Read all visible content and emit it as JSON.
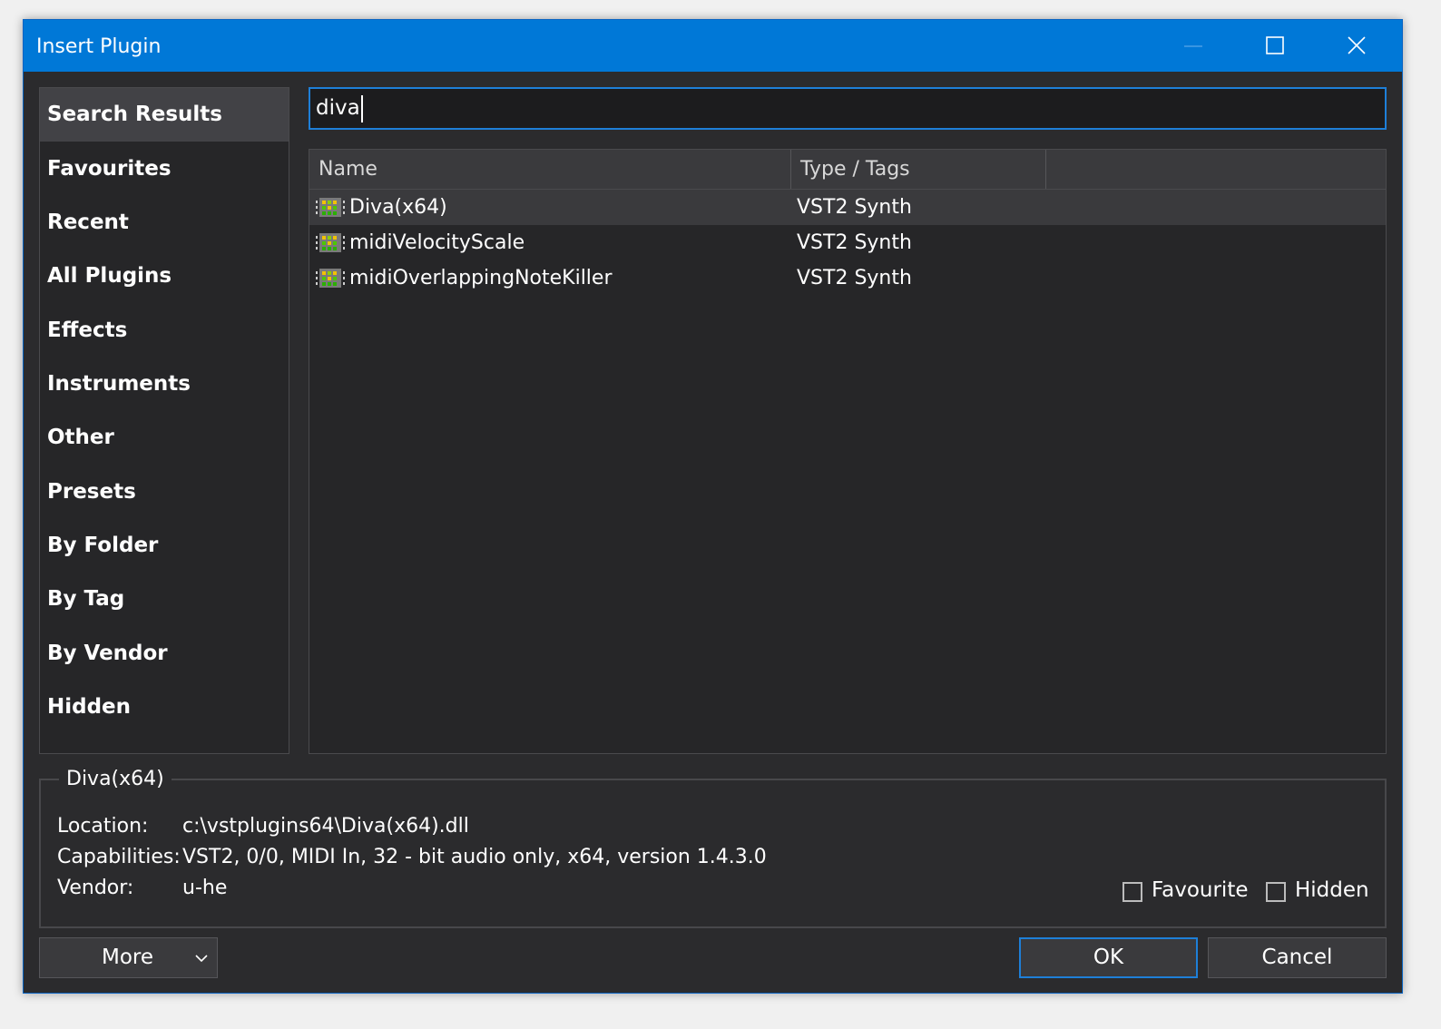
{
  "window": {
    "title": "Insert Plugin"
  },
  "sidebar": {
    "items": [
      {
        "label": "Search Results",
        "active": true
      },
      {
        "label": "Favourites"
      },
      {
        "label": "Recent"
      },
      {
        "label": "All Plugins"
      },
      {
        "label": "Effects"
      },
      {
        "label": "Instruments"
      },
      {
        "label": "Other"
      },
      {
        "label": "Presets"
      },
      {
        "label": "By Folder"
      },
      {
        "label": "By Tag"
      },
      {
        "label": "By Vendor"
      },
      {
        "label": "Hidden"
      }
    ]
  },
  "search": {
    "value": "diva"
  },
  "list": {
    "columns": [
      "Name",
      "Type / Tags",
      ""
    ],
    "rows": [
      {
        "name": "Diva(x64)",
        "type": "VST2 Synth",
        "icon": "plugin-icon",
        "selected": true
      },
      {
        "name": "midiVelocityScale",
        "type": "VST2 Synth",
        "icon": "plugin-icon"
      },
      {
        "name": "midiOverlappingNoteKiller",
        "type": "VST2 Synth",
        "icon": "plugin-icon"
      }
    ]
  },
  "details": {
    "title": "Diva(x64)",
    "location_label": "Location:",
    "location_value": "c:\\vstplugins64\\Diva(x64).dll",
    "capabilities_label": "Capabilities:",
    "capabilities_value": "VST2, 0/0, MIDI In, 32 - bit audio only, x64, version 1.4.3.0",
    "vendor_label": "Vendor:",
    "vendor_value": "u-he",
    "favourite_label": "Favourite",
    "favourite_checked": false,
    "hidden_label": "Hidden",
    "hidden_checked": false
  },
  "buttons": {
    "more": "More",
    "ok": "OK",
    "cancel": "Cancel"
  },
  "colors": {
    "titlebar": "#0078d7",
    "accent": "#1e7fd8",
    "background": "#2b2b2d"
  }
}
